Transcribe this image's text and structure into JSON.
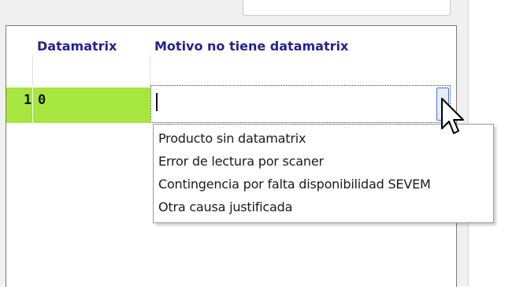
{
  "grid": {
    "columns": {
      "datamatrix": "Datamatrix",
      "motivo": "Motivo no tiene datamatrix"
    },
    "row": {
      "id": "1",
      "datamatrix": "0",
      "motivo_value": ""
    }
  },
  "dropdown": {
    "options": [
      "Producto sin datamatrix",
      "Error de lectura por scaner",
      "Contingencia por falta disponibilidad SEVEM",
      "Otra causa justificada"
    ]
  },
  "colors": {
    "header_text": "#23238f",
    "row_highlight": "#a6e63e",
    "dropdown_button_border": "#3b78d4"
  }
}
